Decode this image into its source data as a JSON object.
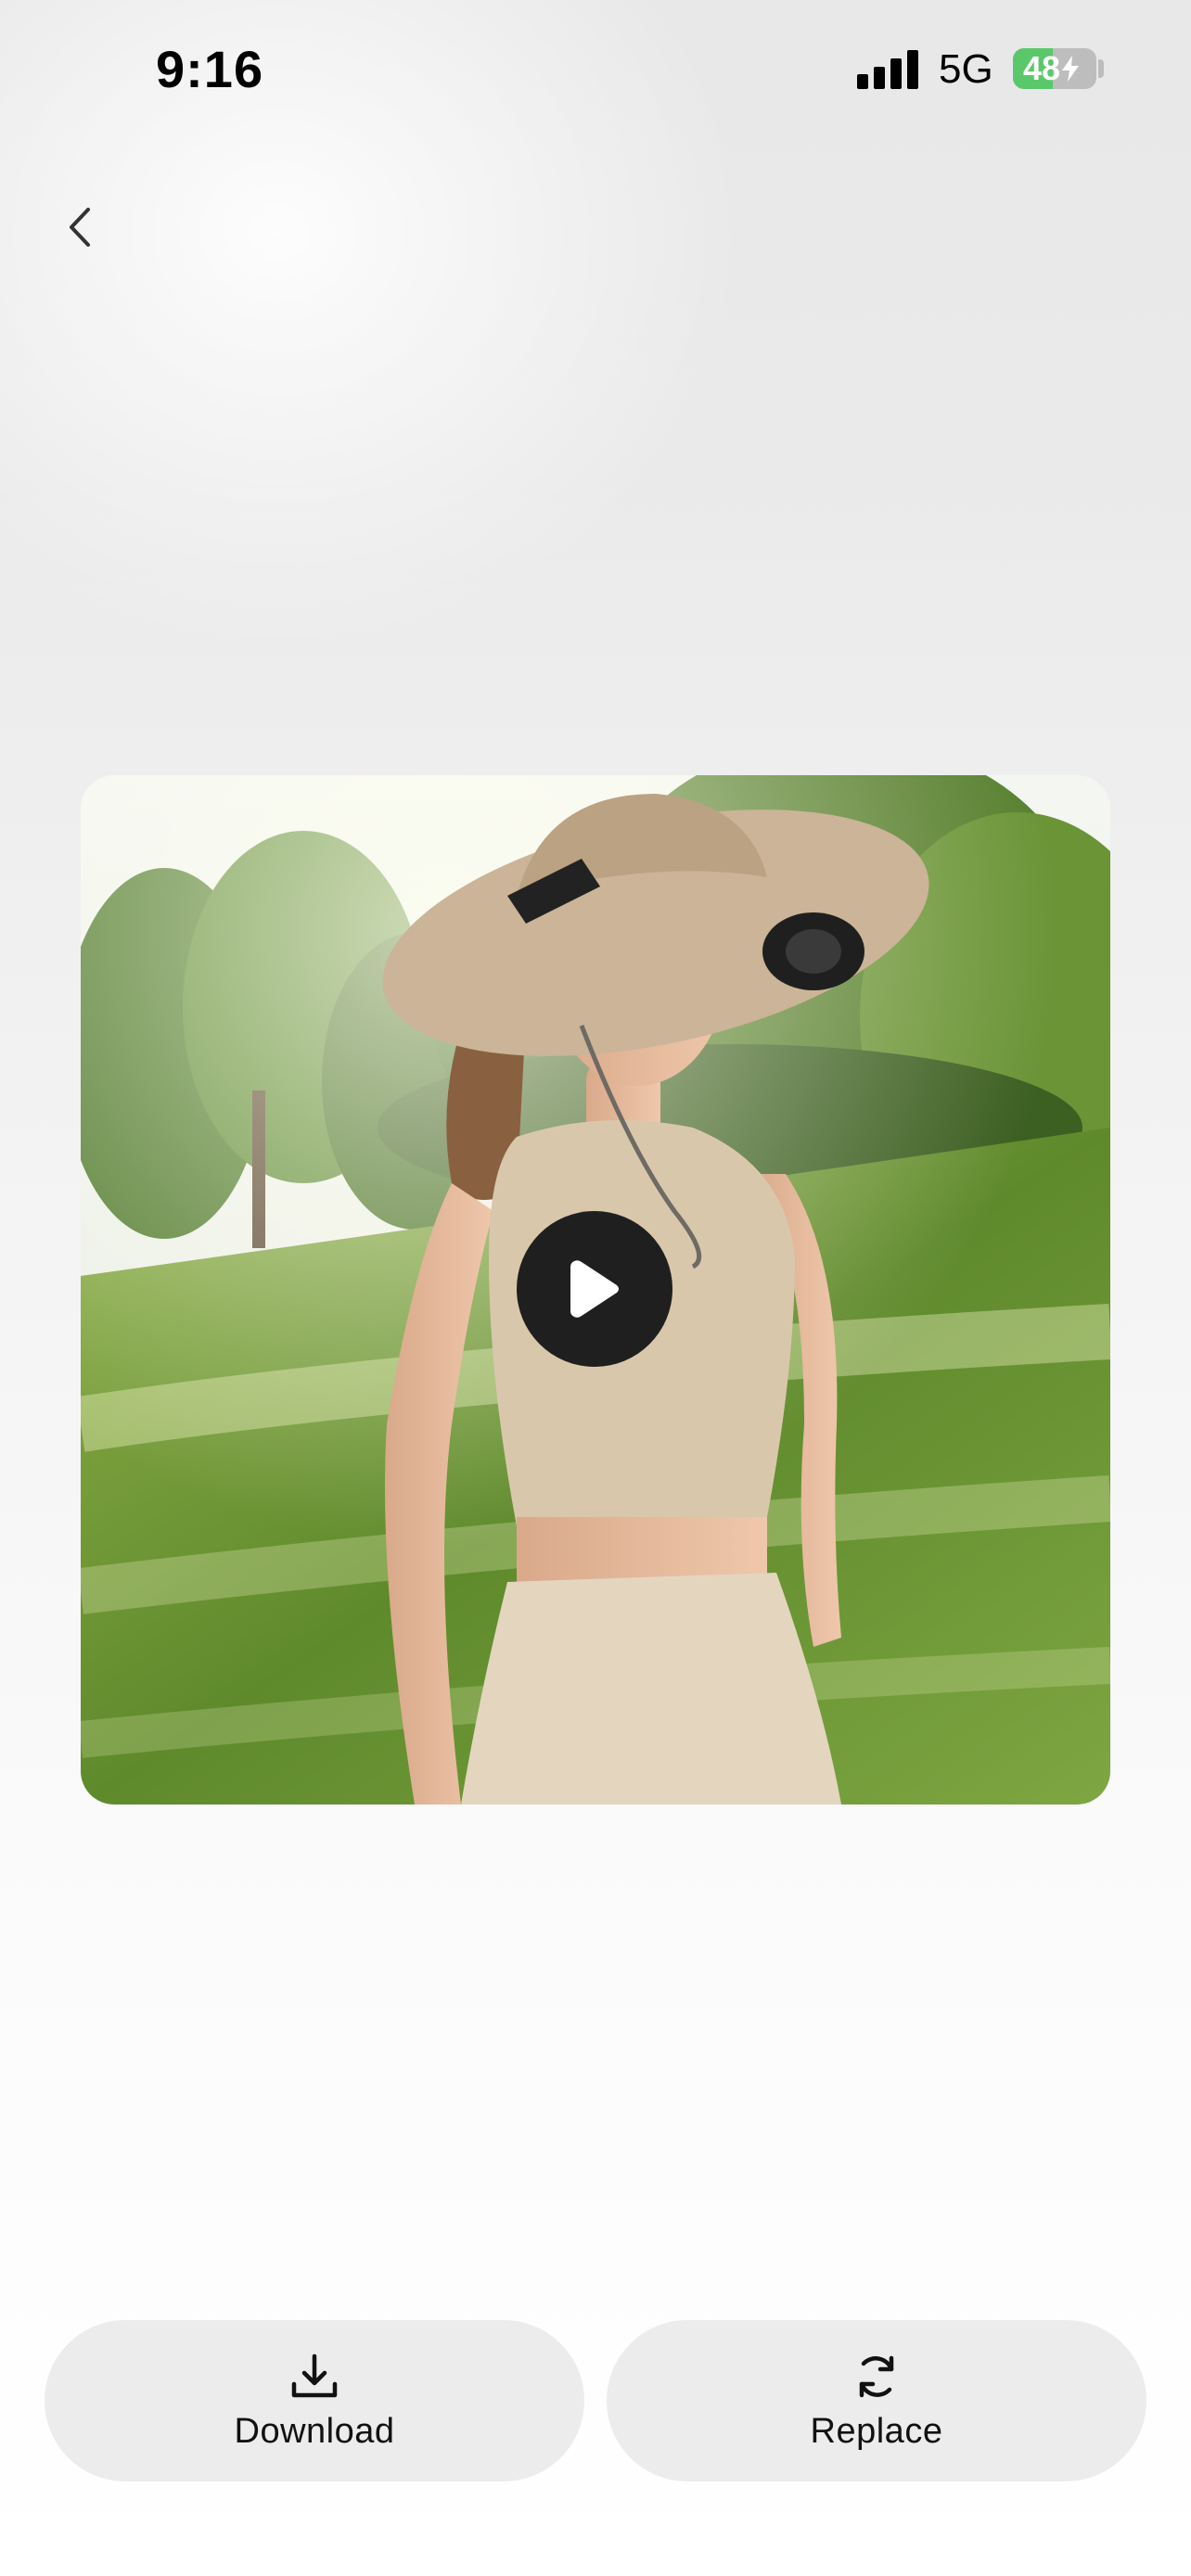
{
  "status_bar": {
    "time": "9:16",
    "network": "5G",
    "battery_level": "48",
    "battery_charging": true,
    "battery_fill_percent": 48
  },
  "nav": {
    "back_icon": "chevron-left-icon"
  },
  "media": {
    "type": "video",
    "play_icon": "play-icon"
  },
  "actions": {
    "download": {
      "label": "Download",
      "icon": "download-icon"
    },
    "replace": {
      "label": "Replace",
      "icon": "refresh-icon"
    }
  },
  "colors": {
    "battery_green": "#5ac86a",
    "button_bg": "#ececec",
    "play_bg": "#1f1f1f"
  }
}
